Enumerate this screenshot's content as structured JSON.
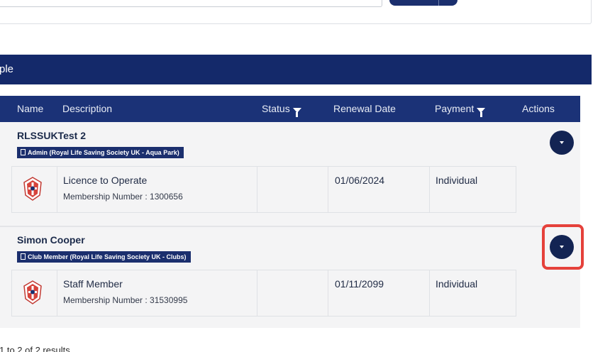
{
  "section": {
    "title": "ple"
  },
  "table": {
    "columns": {
      "name": "Name",
      "description": "Description",
      "status": "Status",
      "renewal": "Renewal Date",
      "payment": "Payment",
      "actions": "Actions"
    }
  },
  "groups": [
    {
      "title": "RLSSUKTest 2",
      "badge": "Admin (Royal Life Saving Society UK - Aqua Park)",
      "item": {
        "name": "Licence to Operate",
        "number": "Membership Number : 1300656",
        "status": "",
        "renewal_date": "01/06/2024",
        "payment": "Individual"
      }
    },
    {
      "title": "Simon Cooper",
      "badge": "Club Member (Royal Life Saving Society UK - Clubs)",
      "item": {
        "name": "Staff Member",
        "number": "Membership Number : 31530995",
        "status": "",
        "renewal_date": "01/11/2099",
        "payment": "Individual"
      }
    }
  ],
  "footer": {
    "results": "1 to 2 of 2 results"
  },
  "icons": {
    "filter": "filter-icon",
    "badge": "building-icon",
    "action": "chevron-down-icon",
    "logo": "rlss-crest-icon"
  },
  "colors": {
    "header_navy": "#14296a",
    "table_head": "#1b3277",
    "action_button": "#132453",
    "row_bg": "#f4f4f5",
    "highlight": "#e5413b"
  }
}
